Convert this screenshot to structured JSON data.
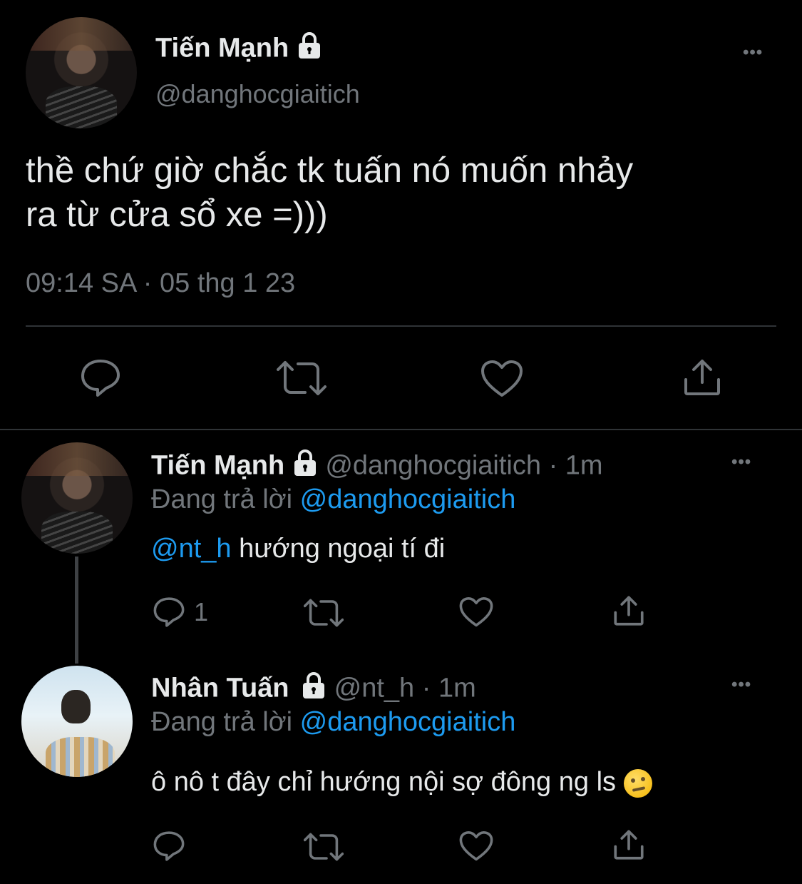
{
  "main_tweet": {
    "display_name": "Tiến Mạnh",
    "handle": "@danghocgiaitich",
    "text_line1": "thề chứ giờ chắc tk tuấn nó muốn nhảy",
    "text_line2": "ra từ cửa sổ xe =)))",
    "timestamp": "09:14 SA · 05 thg 1 23",
    "more": "•••"
  },
  "replies": [
    {
      "display_name": "Tiến Mạnh",
      "handle": "@danghocgiaitich",
      "time": "· 1m",
      "replying_prefix": "Đang trả lời",
      "replying_to": "@danghocgiaitich",
      "mention": "@nt_h",
      "text": "hướng ngoại tí đi",
      "reply_count": "1",
      "more": "•••"
    },
    {
      "display_name": "Nhân Tuấn",
      "handle": "@nt_h",
      "time": "· 1m",
      "replying_prefix": "Đang trả lời",
      "replying_to": "@danghocgiaitich",
      "text": "ô nô t đây chỉ hướng nội sợ đông ng ls",
      "emoji": "thinking-face-emoji",
      "more": "•••"
    }
  ],
  "icons": [
    "lock-icon",
    "reply-icon",
    "retweet-icon",
    "like-icon",
    "share-icon",
    "more-icon"
  ],
  "colors": {
    "background": "#000000",
    "text": "#e7e9ea",
    "muted": "#71767b",
    "accent": "#1d9bf0"
  }
}
